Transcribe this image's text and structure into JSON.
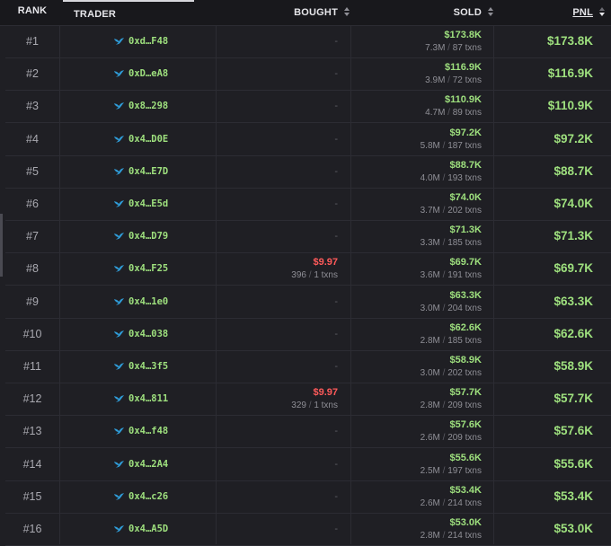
{
  "header": {
    "rank": "RANK",
    "trader": "TRADER",
    "bought": "BOUGHT",
    "sold": "SOLD",
    "pnl": "PNL"
  },
  "colors": {
    "background": "#1f1f24",
    "header_bg": "#18181c",
    "positive": "#9ee07e",
    "negative": "#ff5a5a",
    "muted": "#8f8f96",
    "bird_icon": "#2f9bd6"
  },
  "rows": [
    {
      "rank": "#1",
      "trader": "0xd…F48",
      "bought": {
        "empty": "-"
      },
      "sold": {
        "usd": "$173.8K",
        "tokens": "7.3M",
        "txns": "87 txns"
      },
      "pnl": "$173.8K"
    },
    {
      "rank": "#2",
      "trader": "0xD…eA8",
      "bought": {
        "empty": "-"
      },
      "sold": {
        "usd": "$116.9K",
        "tokens": "3.9M",
        "txns": "72 txns"
      },
      "pnl": "$116.9K"
    },
    {
      "rank": "#3",
      "trader": "0x8…298",
      "bought": {
        "empty": "-"
      },
      "sold": {
        "usd": "$110.9K",
        "tokens": "4.7M",
        "txns": "89 txns"
      },
      "pnl": "$110.9K"
    },
    {
      "rank": "#4",
      "trader": "0x4…D0E",
      "bought": {
        "empty": "-"
      },
      "sold": {
        "usd": "$97.2K",
        "tokens": "5.8M",
        "txns": "187 txns"
      },
      "pnl": "$97.2K"
    },
    {
      "rank": "#5",
      "trader": "0x4…E7D",
      "bought": {
        "empty": "-"
      },
      "sold": {
        "usd": "$88.7K",
        "tokens": "4.0M",
        "txns": "193 txns"
      },
      "pnl": "$88.7K"
    },
    {
      "rank": "#6",
      "trader": "0x4…E5d",
      "bought": {
        "empty": "-"
      },
      "sold": {
        "usd": "$74.0K",
        "tokens": "3.7M",
        "txns": "202 txns"
      },
      "pnl": "$74.0K"
    },
    {
      "rank": "#7",
      "trader": "0x4…D79",
      "bought": {
        "empty": "-"
      },
      "sold": {
        "usd": "$71.3K",
        "tokens": "3.3M",
        "txns": "185 txns"
      },
      "pnl": "$71.3K"
    },
    {
      "rank": "#8",
      "trader": "0x4…F25",
      "bought": {
        "usd": "$9.97",
        "tokens": "396",
        "txns": "1 txns"
      },
      "sold": {
        "usd": "$69.7K",
        "tokens": "3.6M",
        "txns": "191 txns"
      },
      "pnl": "$69.7K"
    },
    {
      "rank": "#9",
      "trader": "0x4…1e0",
      "bought": {
        "empty": "-"
      },
      "sold": {
        "usd": "$63.3K",
        "tokens": "3.0M",
        "txns": "204 txns"
      },
      "pnl": "$63.3K"
    },
    {
      "rank": "#10",
      "trader": "0x4…038",
      "bought": {
        "empty": "-"
      },
      "sold": {
        "usd": "$62.6K",
        "tokens": "2.8M",
        "txns": "185 txns"
      },
      "pnl": "$62.6K"
    },
    {
      "rank": "#11",
      "trader": "0x4…3f5",
      "bought": {
        "empty": "-"
      },
      "sold": {
        "usd": "$58.9K",
        "tokens": "3.0M",
        "txns": "202 txns"
      },
      "pnl": "$58.9K"
    },
    {
      "rank": "#12",
      "trader": "0x4…811",
      "bought": {
        "usd": "$9.97",
        "tokens": "329",
        "txns": "1 txns"
      },
      "sold": {
        "usd": "$57.7K",
        "tokens": "2.8M",
        "txns": "209 txns"
      },
      "pnl": "$57.7K"
    },
    {
      "rank": "#13",
      "trader": "0x4…f48",
      "bought": {
        "empty": "-"
      },
      "sold": {
        "usd": "$57.6K",
        "tokens": "2.6M",
        "txns": "209 txns"
      },
      "pnl": "$57.6K"
    },
    {
      "rank": "#14",
      "trader": "0x4…2A4",
      "bought": {
        "empty": "-"
      },
      "sold": {
        "usd": "$55.6K",
        "tokens": "2.5M",
        "txns": "197 txns"
      },
      "pnl": "$55.6K"
    },
    {
      "rank": "#15",
      "trader": "0x4…c26",
      "bought": {
        "empty": "-"
      },
      "sold": {
        "usd": "$53.4K",
        "tokens": "2.6M",
        "txns": "214 txns"
      },
      "pnl": "$53.4K"
    },
    {
      "rank": "#16",
      "trader": "0x4…A5D",
      "bought": {
        "empty": "-"
      },
      "sold": {
        "usd": "$53.0K",
        "tokens": "2.8M",
        "txns": "214 txns"
      },
      "pnl": "$53.0K"
    }
  ]
}
